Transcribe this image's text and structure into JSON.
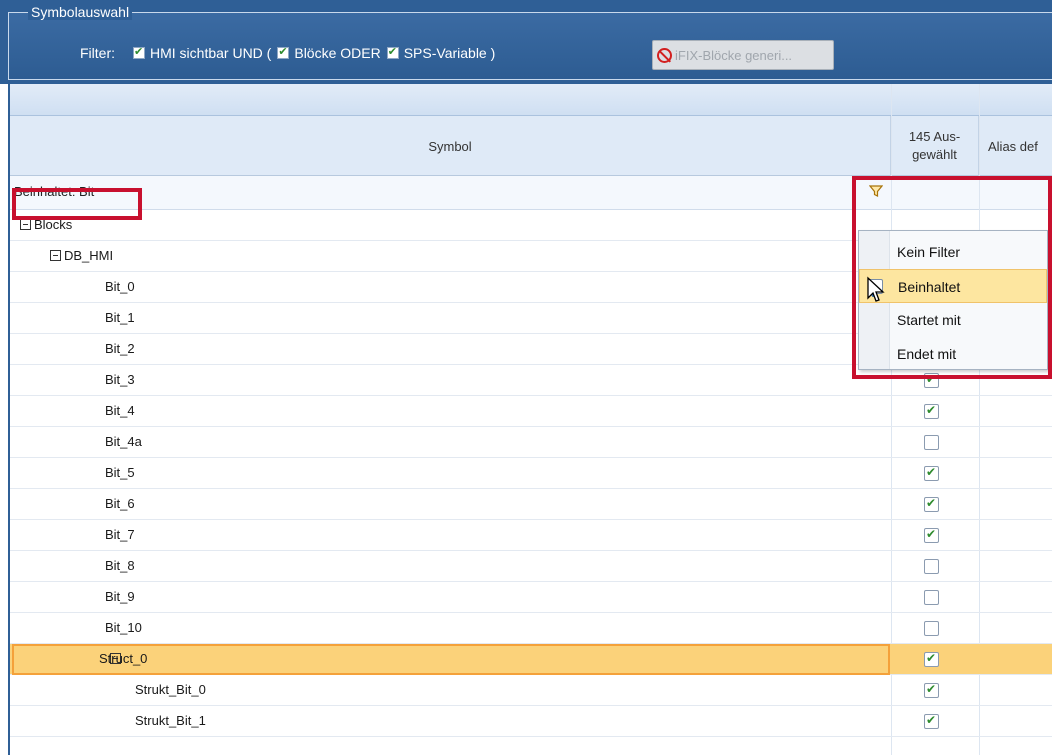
{
  "group": {
    "title": "Symbolauswahl"
  },
  "filter": {
    "label": "Filter:",
    "items": [
      {
        "label": "HMI sichtbar UND (",
        "checked": true
      },
      {
        "label": "Blöcke ODER",
        "checked": true
      },
      {
        "label": "SPS-Variable )",
        "checked": true
      }
    ],
    "generate_button": "iFIX-Blöcke generi..."
  },
  "grid": {
    "columns": [
      {
        "label": "Symbol"
      },
      {
        "label": "145 Aus-\ngewählt"
      },
      {
        "label": "Alias def"
      }
    ],
    "filter_text": "Beinhaltet: Bit",
    "rows": [
      {
        "name": "Blocks",
        "expander": true,
        "checked": true,
        "hidden_check": true
      },
      {
        "name": "DB_HMI",
        "expander": true,
        "checked": null
      },
      {
        "name": "Bit_0",
        "checked": null
      },
      {
        "name": "Bit_1",
        "checked": null
      },
      {
        "name": "Bit_2",
        "checked": null
      },
      {
        "name": "Bit_3",
        "checked": true
      },
      {
        "name": "Bit_4",
        "checked": true
      },
      {
        "name": "Bit_4a",
        "checked": false
      },
      {
        "name": "Bit_5",
        "checked": true
      },
      {
        "name": "Bit_6",
        "checked": true
      },
      {
        "name": "Bit_7",
        "checked": true
      },
      {
        "name": "Bit_8",
        "checked": false
      },
      {
        "name": "Bit_9",
        "checked": false
      },
      {
        "name": "Bit_10",
        "checked": false
      },
      {
        "name": "Struct_0",
        "expander": true,
        "checked": true,
        "selected": true
      },
      {
        "name": "Strukt_Bit_0",
        "checked": true
      },
      {
        "name": "Strukt_Bit_1",
        "checked": true
      }
    ]
  },
  "dropdown": {
    "items": [
      {
        "label": "Kein Filter",
        "checked": false
      },
      {
        "label": "Beinhaltet",
        "checked": true,
        "hover": true
      },
      {
        "label": "Startet mit",
        "checked": false
      },
      {
        "label": "Endet mit",
        "checked": false
      }
    ]
  },
  "colors": {
    "highlight": "#c8102e",
    "panel": "#2f5f96",
    "selection": "#fbd27a"
  },
  "icons": {
    "filter": "funnel-icon",
    "cursor": "arrow-cursor-icon",
    "disabled": "no-entry-icon"
  }
}
